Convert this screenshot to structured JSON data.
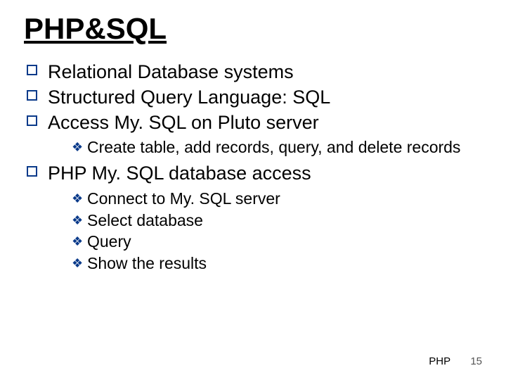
{
  "title": "PHP&SQL",
  "bullets": {
    "b1": "Relational Database systems",
    "b2": "Structured Query Language: SQL",
    "b3": "Access My. SQL on Pluto server",
    "b3_sub": {
      "s1": "Create table, add records, query, and delete records"
    },
    "b4": "PHP My. SQL database access",
    "b4_sub": {
      "s1": "Connect to My. SQL server",
      "s2": "Select database",
      "s3": "Query",
      "s4": "Show the results"
    }
  },
  "footer": {
    "label": "PHP",
    "page": "15"
  }
}
